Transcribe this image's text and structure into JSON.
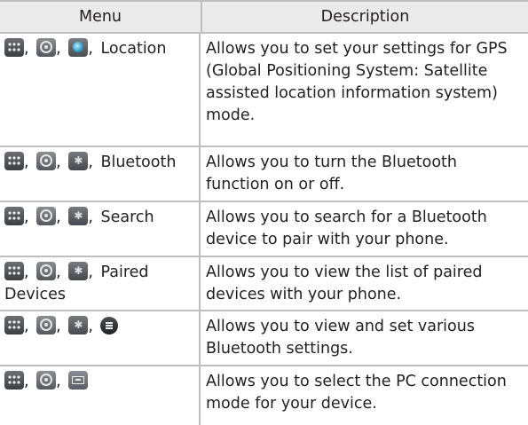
{
  "table": {
    "header": {
      "menu": "Menu",
      "description": "Description"
    },
    "rows": [
      {
        "icons": [
          "apps-icon",
          "gear-icon",
          "location-icon"
        ],
        "label": "Location",
        "description": "Allows you to set your settings for GPS (Global Positioning System: Satellite assisted location information system) mode."
      },
      {
        "icons": [
          "apps-icon",
          "gear-icon",
          "bluetooth-icon"
        ],
        "label": "Bluetooth",
        "description": "Allows you to turn the Bluetooth function on or off."
      },
      {
        "icons": [
          "apps-icon",
          "gear-icon",
          "bluetooth-icon"
        ],
        "label": "Search",
        "description": "Allows you to search for a Bluetooth device to pair with your phone."
      },
      {
        "icons": [
          "apps-icon",
          "gear-icon",
          "bluetooth-icon"
        ],
        "label": "Paired Devices",
        "description": "Allows you to view the list of paired devices with your phone."
      },
      {
        "icons": [
          "apps-icon",
          "gear-icon",
          "bluetooth-icon",
          "menu-icon"
        ],
        "label": "",
        "description": "Allows you to view and set various Bluetooth settings."
      },
      {
        "icons": [
          "apps-icon",
          "gear-icon",
          "pc-connection-icon"
        ],
        "label": "",
        "description": "Allows you to select the PC connection mode for your device."
      }
    ]
  }
}
